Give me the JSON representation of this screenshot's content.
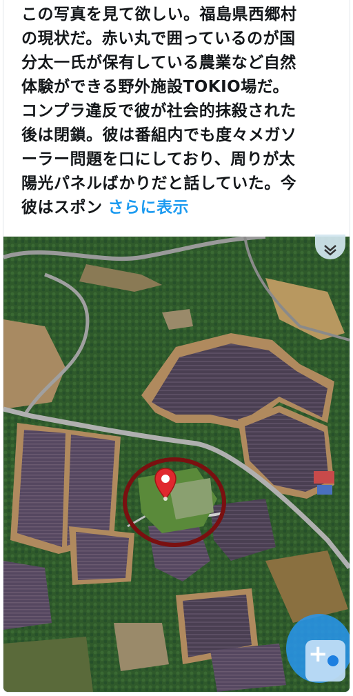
{
  "tweet": {
    "lines": [
      "この写真を見て欲しい。福島県西郷村",
      "の現状だ。赤い丸で囲っているのが国",
      "分太一氏が保有している農業など自然",
      "体験ができる野外施設TOKIO場だ。",
      "コンプラ違反で彼が社会的抹殺された",
      "後は閉鎖。彼は番組内でも度々メガソ",
      "ーラー問題を口にしており、周りが太",
      "陽光パネルばかりだと話していた。今",
      "彼はスポン"
    ],
    "show_more": "さらに表示"
  },
  "map": {
    "marker_icon": "map-pin-icon",
    "layers_icon": "chevron-double-down-icon",
    "fab_icon": "plus-icon"
  },
  "colors": {
    "link": "#1d9bf0",
    "text": "#14171a",
    "annotation_circle": "#7a1010",
    "marker": "#e0282e"
  }
}
